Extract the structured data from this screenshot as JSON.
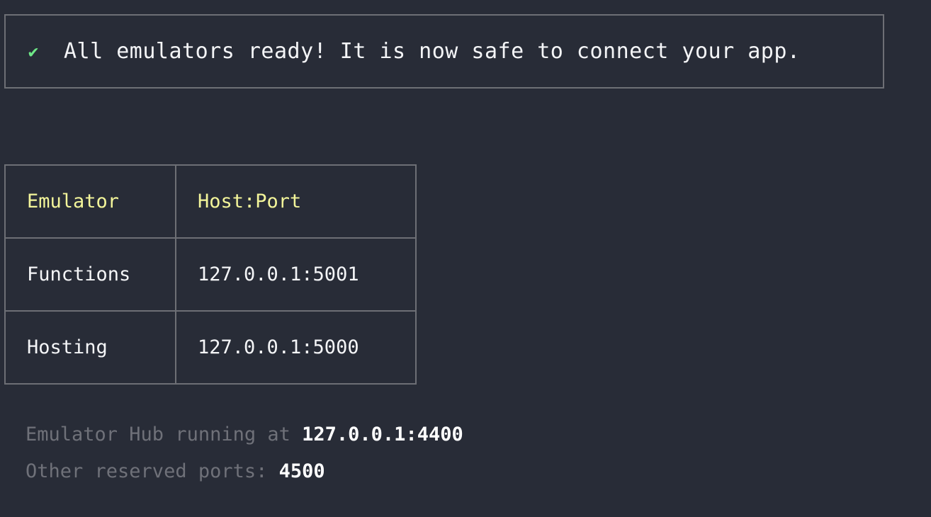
{
  "banner": {
    "icon": "check-icon",
    "icon_glyph": "✔",
    "icon_color": "#6ee787",
    "message": "All emulators ready! It is now safe to connect your app."
  },
  "table": {
    "columns": [
      "Emulator",
      "Host:Port"
    ],
    "rows": [
      {
        "emulator": "Functions",
        "address": "127.0.0.1:5001"
      },
      {
        "emulator": "Hosting",
        "address": "127.0.0.1:5000"
      }
    ]
  },
  "footer": {
    "hub_label": "Emulator Hub running at ",
    "hub_value": "127.0.0.1:4400",
    "reserved_label": "Other reserved ports: ",
    "reserved_value": "4500"
  },
  "colors": {
    "background": "#282c37",
    "border": "#6d6f75",
    "header_text": "#f3f59a",
    "body_text": "#f4f5f7",
    "muted_text": "#6f7179",
    "accent_success": "#6ee787",
    "value_text": "#ffffff"
  }
}
